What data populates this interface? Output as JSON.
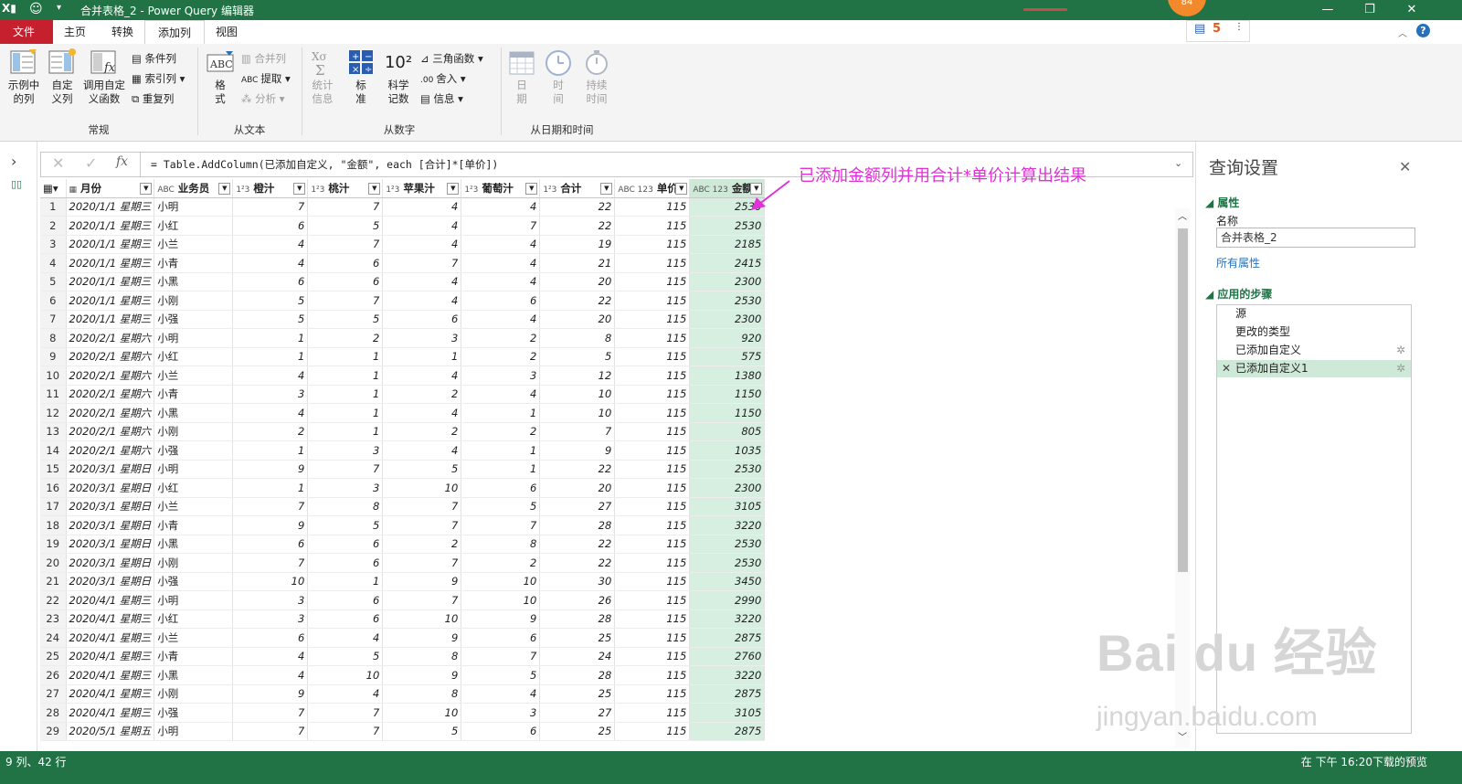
{
  "window": {
    "title": "合并表格_2 - Power Query 编辑器",
    "badge": "84",
    "accent": "#217346"
  },
  "tabs": [
    {
      "label": "文件"
    },
    {
      "label": "主页"
    },
    {
      "label": "转换"
    },
    {
      "label": "添加列"
    },
    {
      "label": "视图"
    }
  ],
  "ribbon": {
    "group_general": {
      "label": "常规",
      "example_col": "示例中\n的列",
      "custom_col": "自定\n义列",
      "invoke_fn": "调用自定\n义函数",
      "cond_col": "条件列",
      "index_col": "索引列",
      "dup_col": "重复列"
    },
    "group_text": {
      "label": "从文本",
      "format": "格\n式",
      "merge_cols": "合并列",
      "extract": "提取",
      "parse": "分析"
    },
    "group_number": {
      "label": "从数字",
      "stats": "统计\n信息",
      "standard": "标\n准",
      "scientific": "科学\n记数",
      "trig": "三角函数",
      "rounding": "舍入",
      "info": "信息",
      "sci_glyph": "10²"
    },
    "group_date": {
      "label": "从日期和时间",
      "date": "日\n期",
      "time": "时\n间",
      "duration": "持续\n时间"
    }
  },
  "formula": {
    "text": "= Table.AddColumn(已添加自定义, \"金额\", each [合计]*[单价])",
    "fx": "fx"
  },
  "annotation": "已添加金额列并用合计*单价计算出结果",
  "table": {
    "columns": [
      {
        "type": "▦",
        "label": "月份"
      },
      {
        "type": "ABC",
        "label": "业务员"
      },
      {
        "type": "1²3",
        "label": "橙汁"
      },
      {
        "type": "1²3",
        "label": "桃汁"
      },
      {
        "type": "1²3",
        "label": "苹果汁"
      },
      {
        "type": "1²3",
        "label": "葡萄汁"
      },
      {
        "type": "1²3",
        "label": "合计"
      },
      {
        "type": "ABC 123",
        "label": "单价"
      },
      {
        "type": "ABC 123",
        "label": "金额"
      }
    ],
    "rows": [
      [
        "2020/1/1 星期三",
        "小明",
        "7",
        "7",
        "4",
        "4",
        "22",
        "115",
        "2530"
      ],
      [
        "2020/1/1 星期三",
        "小红",
        "6",
        "5",
        "4",
        "7",
        "22",
        "115",
        "2530"
      ],
      [
        "2020/1/1 星期三",
        "小兰",
        "4",
        "7",
        "4",
        "4",
        "19",
        "115",
        "2185"
      ],
      [
        "2020/1/1 星期三",
        "小青",
        "4",
        "6",
        "7",
        "4",
        "21",
        "115",
        "2415"
      ],
      [
        "2020/1/1 星期三",
        "小黑",
        "6",
        "6",
        "4",
        "4",
        "20",
        "115",
        "2300"
      ],
      [
        "2020/1/1 星期三",
        "小刚",
        "5",
        "7",
        "4",
        "6",
        "22",
        "115",
        "2530"
      ],
      [
        "2020/1/1 星期三",
        "小强",
        "5",
        "5",
        "6",
        "4",
        "20",
        "115",
        "2300"
      ],
      [
        "2020/2/1 星期六",
        "小明",
        "1",
        "2",
        "3",
        "2",
        "8",
        "115",
        "920"
      ],
      [
        "2020/2/1 星期六",
        "小红",
        "1",
        "1",
        "1",
        "2",
        "5",
        "115",
        "575"
      ],
      [
        "2020/2/1 星期六",
        "小兰",
        "4",
        "1",
        "4",
        "3",
        "12",
        "115",
        "1380"
      ],
      [
        "2020/2/1 星期六",
        "小青",
        "3",
        "1",
        "2",
        "4",
        "10",
        "115",
        "1150"
      ],
      [
        "2020/2/1 星期六",
        "小黑",
        "4",
        "1",
        "4",
        "1",
        "10",
        "115",
        "1150"
      ],
      [
        "2020/2/1 星期六",
        "小刚",
        "2",
        "1",
        "2",
        "2",
        "7",
        "115",
        "805"
      ],
      [
        "2020/2/1 星期六",
        "小强",
        "1",
        "3",
        "4",
        "1",
        "9",
        "115",
        "1035"
      ],
      [
        "2020/3/1 星期日",
        "小明",
        "9",
        "7",
        "5",
        "1",
        "22",
        "115",
        "2530"
      ],
      [
        "2020/3/1 星期日",
        "小红",
        "1",
        "3",
        "10",
        "6",
        "20",
        "115",
        "2300"
      ],
      [
        "2020/3/1 星期日",
        "小兰",
        "7",
        "8",
        "7",
        "5",
        "27",
        "115",
        "3105"
      ],
      [
        "2020/3/1 星期日",
        "小青",
        "9",
        "5",
        "7",
        "7",
        "28",
        "115",
        "3220"
      ],
      [
        "2020/3/1 星期日",
        "小黑",
        "6",
        "6",
        "2",
        "8",
        "22",
        "115",
        "2530"
      ],
      [
        "2020/3/1 星期日",
        "小刚",
        "7",
        "6",
        "7",
        "2",
        "22",
        "115",
        "2530"
      ],
      [
        "2020/3/1 星期日",
        "小强",
        "10",
        "1",
        "9",
        "10",
        "30",
        "115",
        "3450"
      ],
      [
        "2020/4/1 星期三",
        "小明",
        "3",
        "6",
        "7",
        "10",
        "26",
        "115",
        "2990"
      ],
      [
        "2020/4/1 星期三",
        "小红",
        "3",
        "6",
        "10",
        "9",
        "28",
        "115",
        "3220"
      ],
      [
        "2020/4/1 星期三",
        "小兰",
        "6",
        "4",
        "9",
        "6",
        "25",
        "115",
        "2875"
      ],
      [
        "2020/4/1 星期三",
        "小青",
        "4",
        "5",
        "8",
        "7",
        "24",
        "115",
        "2760"
      ],
      [
        "2020/4/1 星期三",
        "小黑",
        "4",
        "10",
        "9",
        "5",
        "28",
        "115",
        "3220"
      ],
      [
        "2020/4/1 星期三",
        "小刚",
        "9",
        "4",
        "8",
        "4",
        "25",
        "115",
        "2875"
      ],
      [
        "2020/4/1 星期三",
        "小强",
        "7",
        "7",
        "10",
        "3",
        "27",
        "115",
        "3105"
      ],
      [
        "2020/5/1 星期五",
        "小明",
        "7",
        "7",
        "5",
        "6",
        "25",
        "115",
        "2875"
      ]
    ]
  },
  "query_settings": {
    "title": "查询设置",
    "properties_label": "属性",
    "name_label": "名称",
    "name_value": "合并表格_2",
    "all_properties": "所有属性",
    "steps_label": "应用的步骤",
    "steps": [
      "源",
      "更改的类型",
      "已添加自定义",
      "已添加自定义1"
    ]
  },
  "status": {
    "left": "9 列、42 行",
    "right": "在 下午 16:20下载的预览"
  },
  "watermark": {
    "logo": "Bai du 经验",
    "url": "jingyan.baidu.com"
  }
}
